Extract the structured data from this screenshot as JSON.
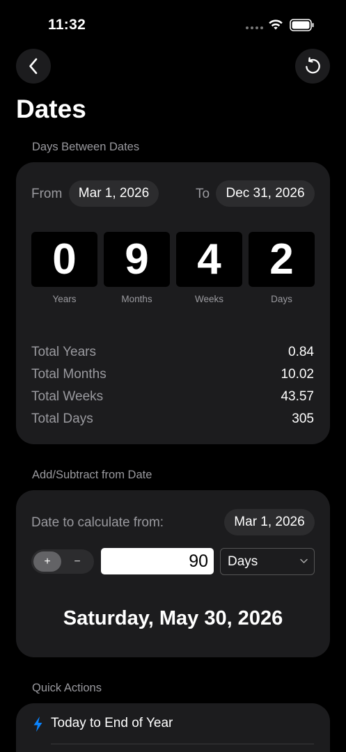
{
  "status_bar": {
    "time": "11:32"
  },
  "page": {
    "title": "Dates"
  },
  "between": {
    "section_label": "Days Between Dates",
    "from_label": "From",
    "from_date": "Mar 1, 2026",
    "to_label": "To",
    "to_date": "Dec 31, 2026",
    "breakdown": [
      {
        "value": "0",
        "label": "Years"
      },
      {
        "value": "9",
        "label": "Months"
      },
      {
        "value": "4",
        "label": "Weeks"
      },
      {
        "value": "2",
        "label": "Days"
      }
    ],
    "totals": [
      {
        "label": "Total Years",
        "value": "0.84"
      },
      {
        "label": "Total Months",
        "value": "10.02"
      },
      {
        "label": "Total Weeks",
        "value": "43.57"
      },
      {
        "label": "Total Days",
        "value": "305"
      }
    ]
  },
  "add_subtract": {
    "section_label": "Add/Subtract from Date",
    "calc_from_label": "Date to calculate from:",
    "calc_from_date": "Mar 1, 2026",
    "plus_label": "+",
    "minus_label": "−",
    "amount": "90",
    "unit": "Days",
    "result": "Saturday, May 30, 2026"
  },
  "quick_actions": {
    "section_label": "Quick Actions",
    "items": [
      {
        "label": "Today to End of Year",
        "icon": "bolt-icon"
      }
    ]
  },
  "colors": {
    "background": "#000000",
    "card": "#1c1c1e",
    "pill": "#2c2c2e",
    "muted_text": "#9a9a9f",
    "accent_blue": "#0a84ff"
  }
}
